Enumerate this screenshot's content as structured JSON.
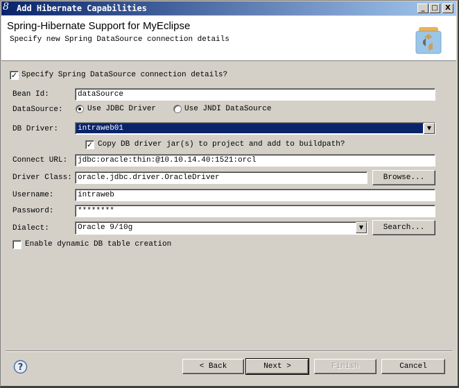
{
  "window": {
    "title": "Add Hibernate Capabilities",
    "minimize": "_",
    "maximize": "□",
    "close": "X"
  },
  "header": {
    "title": "Spring-Hibernate Support for MyEclipse",
    "subtitle": "Specify new Spring DataSource connection details"
  },
  "form": {
    "specify_label": "Specify Spring DataSource connection details?",
    "specify_checked": true,
    "bean_id_label": "Bean Id:",
    "bean_id": "dataSource",
    "datasource_label": "DataSource:",
    "use_jdbc": "Use JDBC Driver",
    "use_jndi": "Use JNDI DataSource",
    "datasource_selected": "Use JDBC Driver",
    "db_driver_label": "DB Driver:",
    "db_driver": "intraweb01",
    "copy_label": "Copy DB driver jar(s) to project and add to buildpath?",
    "copy_checked": true,
    "connect_url_label": "Connect URL:",
    "connect_url": "jdbc:oracle:thin:@10.10.14.40:1521:orcl",
    "driver_class_label": "Driver Class:",
    "driver_class": "oracle.jdbc.driver.OracleDriver",
    "browse": "Browse...",
    "username_label": "Username:",
    "username": "intraweb",
    "password_label": "Password:",
    "password": "********",
    "dialect_label": "Dialect:",
    "dialect": "Oracle 9/10g",
    "search": "Search...",
    "enable_label": "Enable dynamic DB table creation",
    "enable_checked": false
  },
  "footer": {
    "back": "< Back",
    "next": "Next >",
    "finish": "Finish",
    "cancel": "Cancel"
  }
}
